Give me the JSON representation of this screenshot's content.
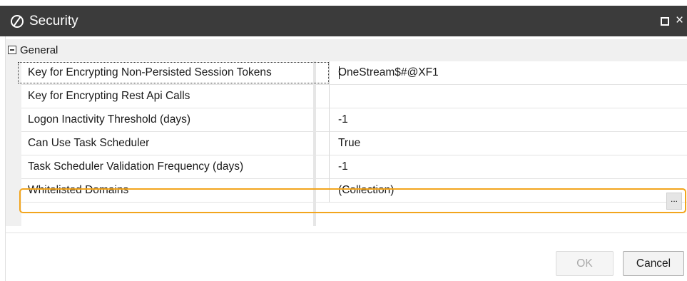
{
  "window": {
    "title": "Security",
    "close_glyph": "×",
    "icon": "onestream-logo-icon"
  },
  "grid": {
    "category": "General",
    "rows": [
      {
        "name": "Key for Encrypting Non-Persisted Session Tokens",
        "value": "OneStream$#@XF1"
      },
      {
        "name": "Key for Encrypting Rest Api Calls",
        "value": ""
      },
      {
        "name": "Logon Inactivity Threshold (days)",
        "value": "-1"
      },
      {
        "name": "Can Use Task Scheduler",
        "value": "True"
      },
      {
        "name": "Task Scheduler Validation Frequency (days)",
        "value": "-1"
      },
      {
        "name": "Whitelisted Domains",
        "value": "(Collection)"
      }
    ],
    "ellipsis_label": "...",
    "highlight_color": "#f2a51d"
  },
  "footer": {
    "ok_label": "OK",
    "cancel_label": "Cancel"
  },
  "colors": {
    "titlebar": "#3b3b3b",
    "category_bg": "#f0f0f0"
  }
}
